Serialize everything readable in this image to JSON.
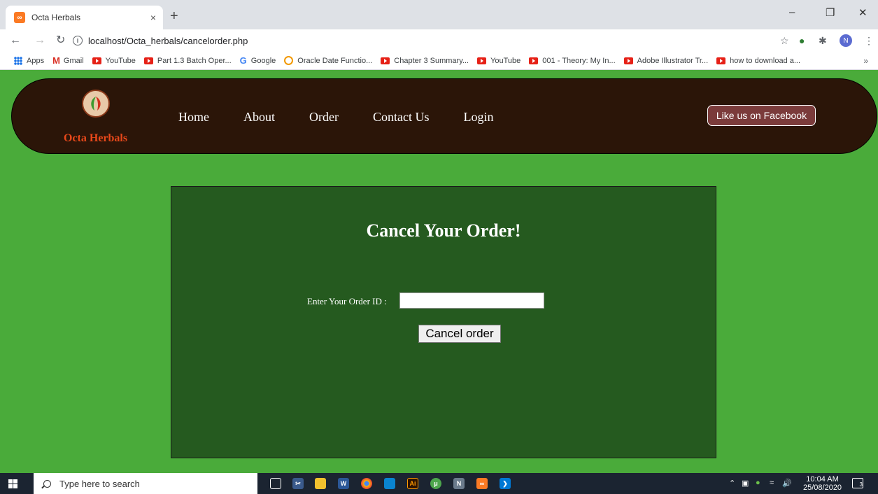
{
  "browser": {
    "tab_title": "Octa Herbals",
    "tab_close": "×",
    "new_tab": "+",
    "url": "localhost/Octa_herbals/cancelorder.php",
    "profile_initial": "N",
    "window_controls": {
      "minimize": "–",
      "restore": "❐",
      "close": "✕"
    }
  },
  "bookmarks": [
    {
      "label": "Apps",
      "icon": "apps-grid-icon"
    },
    {
      "label": "Gmail",
      "icon": "gmail-icon"
    },
    {
      "label": "YouTube",
      "icon": "youtube-icon"
    },
    {
      "label": "Part 1.3 Batch Oper...",
      "icon": "youtube-icon"
    },
    {
      "label": "Google",
      "icon": "google-icon"
    },
    {
      "label": "Oracle Date Functio...",
      "icon": "oracle-icon"
    },
    {
      "label": "Chapter 3 Summary...",
      "icon": "youtube-icon"
    },
    {
      "label": "YouTube",
      "icon": "youtube-icon"
    },
    {
      "label": "001 - Theory: My In...",
      "icon": "youtube-icon"
    },
    {
      "label": "Adobe Illustrator Tr...",
      "icon": "youtube-icon"
    },
    {
      "label": "how to download a...",
      "icon": "youtube-icon"
    }
  ],
  "site": {
    "brand": "Octa Herbals",
    "nav": [
      "Home",
      "About",
      "Order",
      "Contact Us",
      "Login"
    ],
    "facebook_button": "Like us on Facebook",
    "header_color": "#2b1508",
    "page_bg": "#4aab3a",
    "panel_bg": "#255a1f"
  },
  "form": {
    "heading": "Cancel Your Order!",
    "order_id_label": "Enter Your Order ID :",
    "order_id_value": "",
    "submit_label": "Cancel order"
  },
  "taskbar": {
    "search_placeholder": "Type here to search",
    "time": "10:04 AM",
    "date": "25/08/2020",
    "notification_count": "3"
  }
}
